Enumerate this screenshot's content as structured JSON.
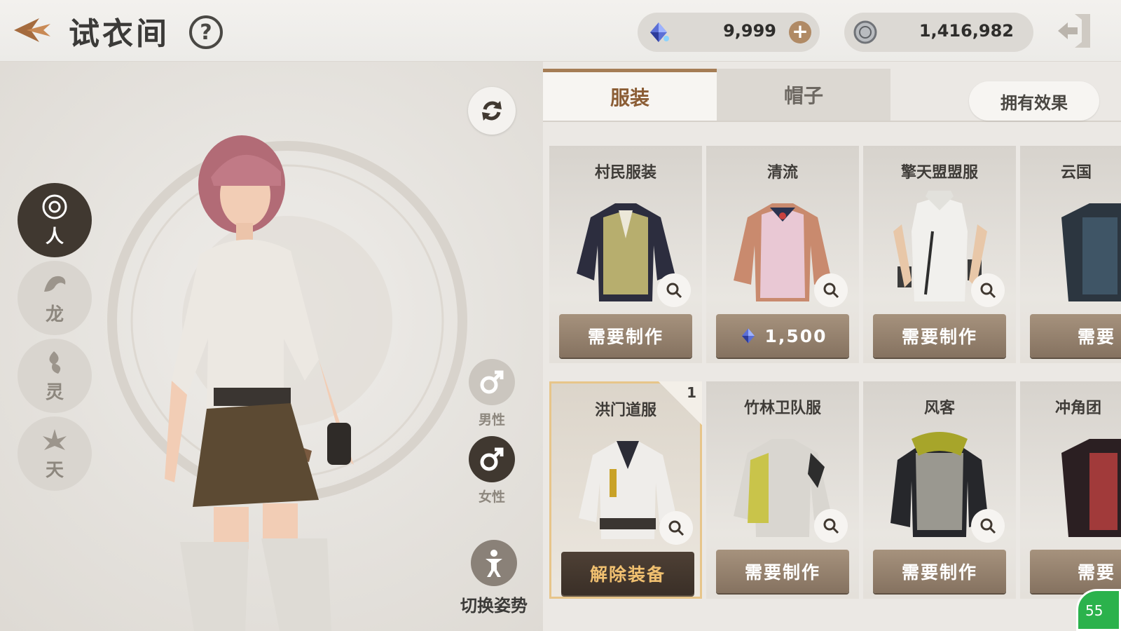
{
  "header": {
    "title": "试衣间",
    "help_label": "?",
    "gems": {
      "value": "9,999",
      "plus_label": "+"
    },
    "silver": {
      "value": "1,416,982"
    }
  },
  "races": [
    {
      "label": "人",
      "active": true
    },
    {
      "label": "龙",
      "active": false
    },
    {
      "label": "灵",
      "active": false
    },
    {
      "label": "天",
      "active": false
    }
  ],
  "gender": {
    "male_label": "男性",
    "female_label": "女性",
    "selected": "female"
  },
  "pose_label": "切换姿势",
  "tabs": {
    "clothes": "服装",
    "hat": "帽子",
    "active": "clothes"
  },
  "effect_button": "拥有效果",
  "items": [
    {
      "name": "村民服装",
      "button": "需要制作"
    },
    {
      "name": "清流",
      "button": "1,500",
      "price_icon": "gem-icon"
    },
    {
      "name": "擎天盟盟服",
      "button": "需要制作"
    },
    {
      "name": "云国",
      "button": "需要"
    },
    {
      "name": "洪门道服",
      "button": "解除装备",
      "equipped": true,
      "badge": "1"
    },
    {
      "name": "竹林卫队服",
      "button": "需要制作"
    },
    {
      "name": "风客",
      "button": "需要制作"
    },
    {
      "name": "冲角团",
      "button": "需要"
    }
  ],
  "status_badge": "55",
  "colors": {
    "accent": "#a57d55",
    "dark": "#403830",
    "button": "#97826d",
    "equipped_text": "#f0c070"
  }
}
